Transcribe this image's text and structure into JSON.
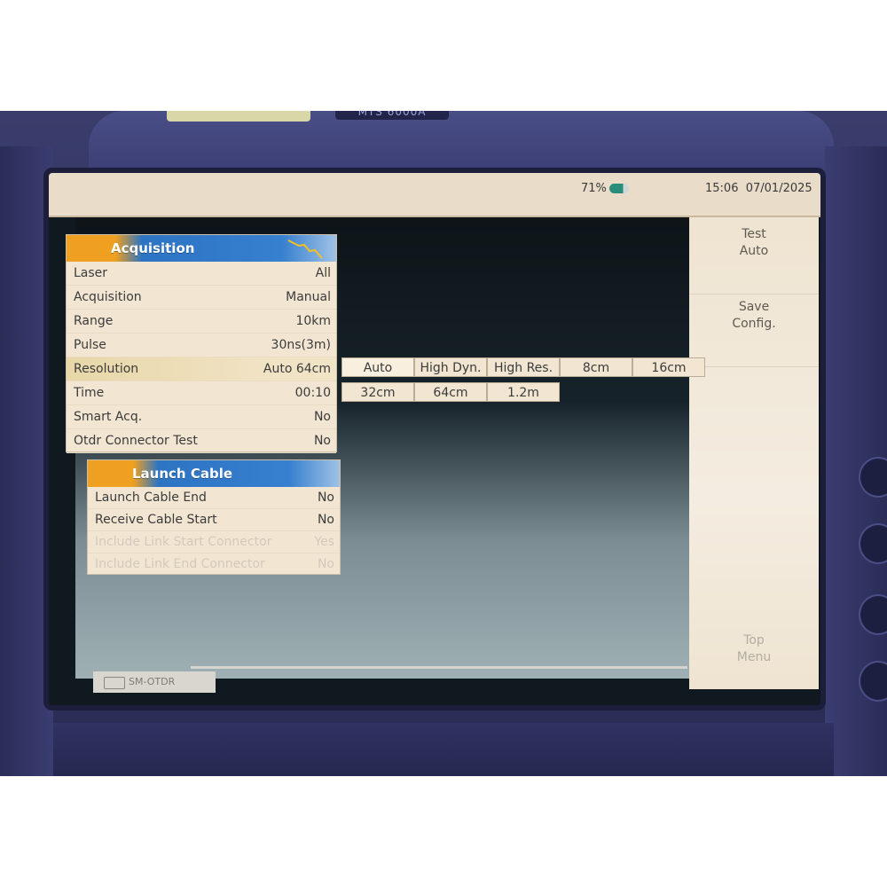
{
  "device": {
    "model_text": "MTS 6000A"
  },
  "status_bar": {
    "battery_percent": "71%",
    "time": "15:06",
    "date": "07/01/2025"
  },
  "acquisition_panel": {
    "title": "Acquisition",
    "rows": [
      {
        "label": "Laser",
        "value": "All"
      },
      {
        "label": "Acquisition",
        "value": "Manual"
      },
      {
        "label": "Range",
        "value": "10km"
      },
      {
        "label": "Pulse",
        "value": "30ns(3m)"
      },
      {
        "label": "Resolution",
        "value": "Auto 64cm"
      },
      {
        "label": "Time",
        "value": "00:10"
      },
      {
        "label": "Smart Acq.",
        "value": "No"
      },
      {
        "label": "Otdr Connector Test",
        "value": "No"
      }
    ]
  },
  "resolution_options": [
    "Auto",
    "High Dyn.",
    "High Res.",
    "8cm",
    "16cm",
    "32cm",
    "64cm",
    "1.2m"
  ],
  "launch_cable_panel": {
    "title": "Launch Cable",
    "rows": [
      {
        "label": "Launch Cable End",
        "value": "No"
      },
      {
        "label": "Receive Cable Start",
        "value": "No"
      },
      {
        "label": "Include Link Start Connector",
        "value": "Yes"
      },
      {
        "label": "Include Link End Connector",
        "value": "No"
      }
    ]
  },
  "right_menu": {
    "test_auto": [
      "Test",
      "Auto"
    ],
    "save_config": [
      "Save",
      "Config."
    ],
    "top_menu": [
      "Top",
      "Menu"
    ]
  },
  "bottom_tab": {
    "label": "SM-OTDR"
  }
}
